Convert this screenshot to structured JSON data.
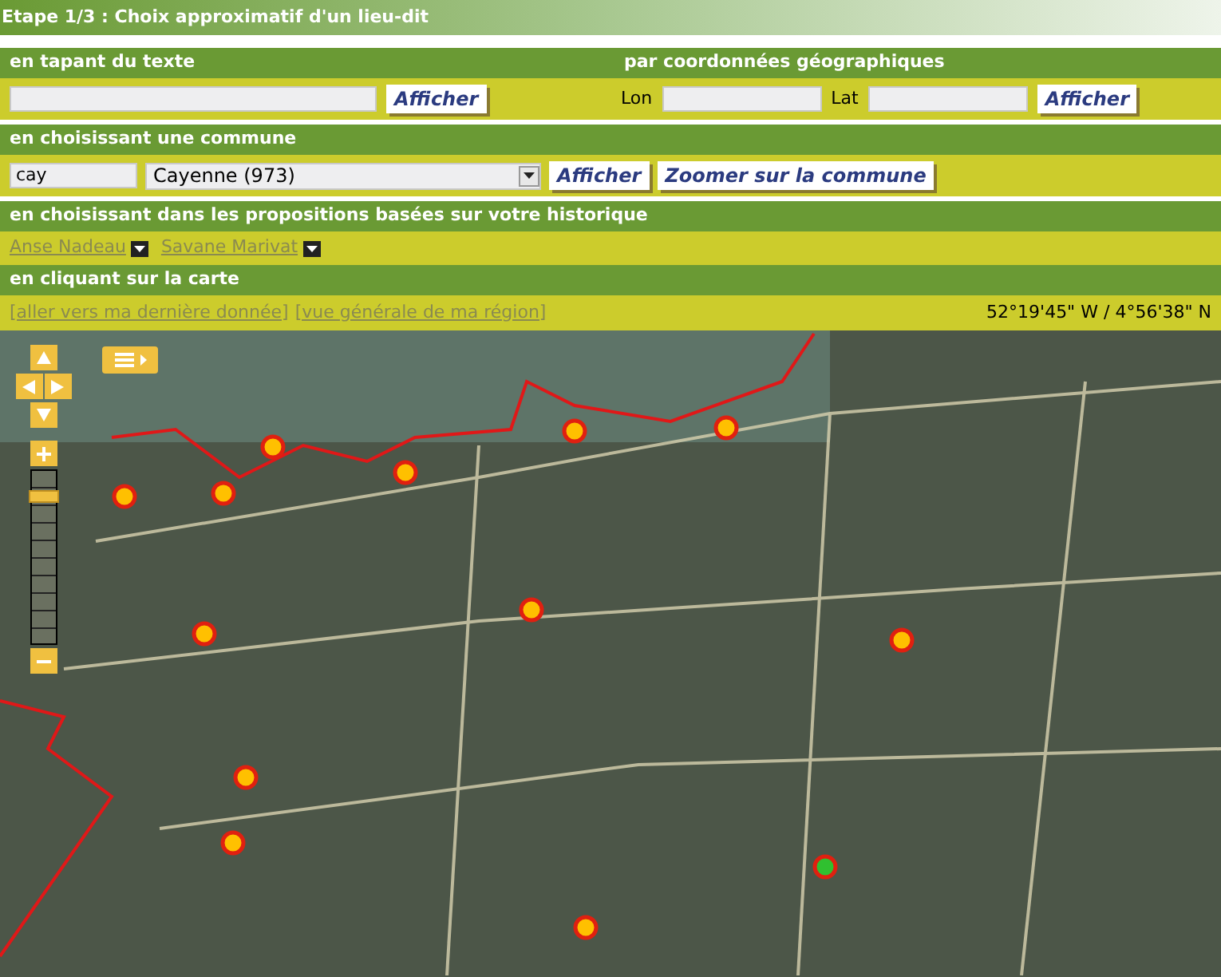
{
  "title": "Etape 1/3 : Choix approximatif d'un lieu-dit",
  "text_search": {
    "heading": "en tapant du texte",
    "button": "Afficher"
  },
  "coord_search": {
    "heading": "par coordonnées géographiques",
    "lon_label": "Lon",
    "lat_label": "Lat",
    "button": "Afficher"
  },
  "commune": {
    "heading": "en choisissant une commune",
    "filter_value": "cay",
    "select_value": "Cayenne (973)",
    "buttons": [
      "Afficher",
      "Zoomer sur la commune"
    ]
  },
  "history": {
    "heading": "en choisissant dans les propositions basées sur votre historique",
    "items": [
      {
        "label": "Anse Nadeau"
      },
      {
        "label": "Savane Marivat"
      }
    ]
  },
  "map_section": {
    "heading": "en cliquant sur la carte",
    "links": [
      "[aller vers ma dernière donnée]",
      "[vue générale de ma région]"
    ],
    "coordinates": "52°19'45\" W / 4°56'38\" N"
  },
  "map": {
    "zoom": {
      "level": 0.88
    }
  }
}
